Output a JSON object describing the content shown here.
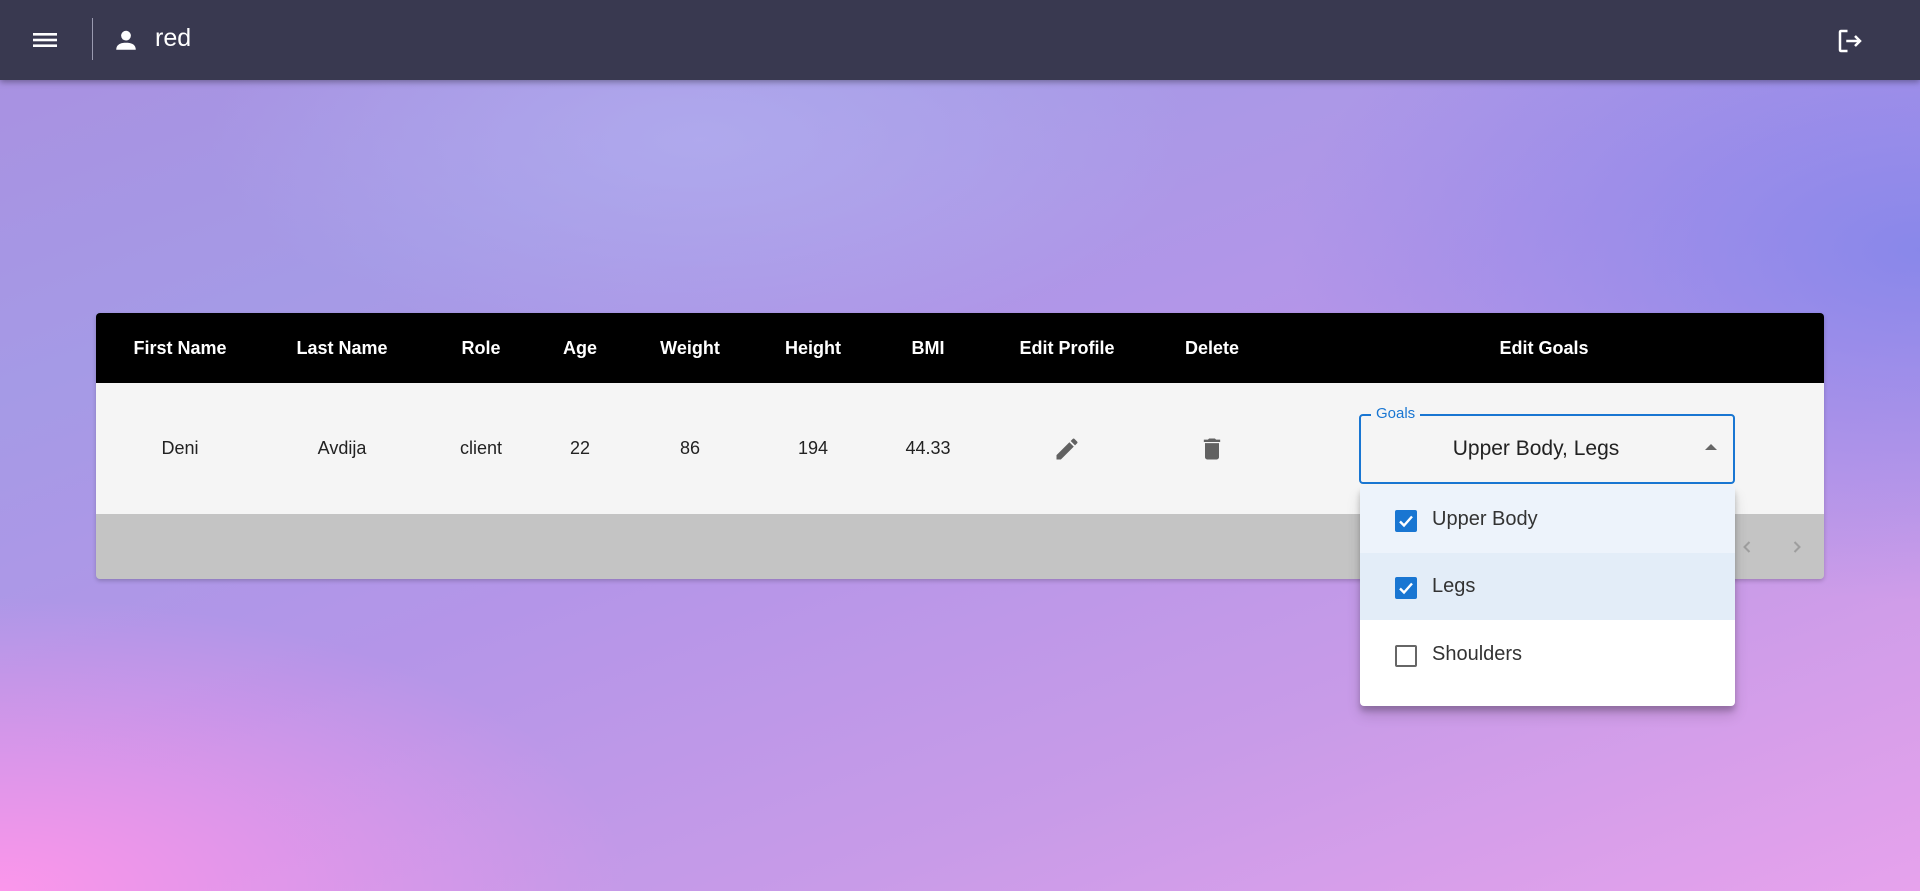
{
  "header": {
    "user_name": "red",
    "icons": [
      "menu-icon",
      "person-icon",
      "logout-icon"
    ]
  },
  "table": {
    "columns": [
      "First Name",
      "Last Name",
      "Role",
      "Age",
      "Weight",
      "Height",
      "BMI",
      "Edit Profile",
      "Delete",
      "Edit Goals"
    ],
    "rows": [
      {
        "first_name": "Deni",
        "last_name": "Avdija",
        "role": "client",
        "age": "22",
        "weight": "86",
        "height": "194",
        "bmi": "44.33",
        "edit_icon": "pencil-icon",
        "delete_icon": "trash-icon"
      }
    ]
  },
  "goals_select": {
    "label": "Goals",
    "value": "Upper Body, Legs",
    "options": [
      {
        "label": "Upper Body",
        "checked": true
      },
      {
        "label": "Legs",
        "checked": true
      },
      {
        "label": "Shoulders",
        "checked": false
      }
    ]
  },
  "colors": {
    "appbar": "#393950",
    "accent": "#1976d2",
    "table_header": "#000000",
    "table_row": "#f5f5f5",
    "table_footer": "#c4c4c4"
  }
}
